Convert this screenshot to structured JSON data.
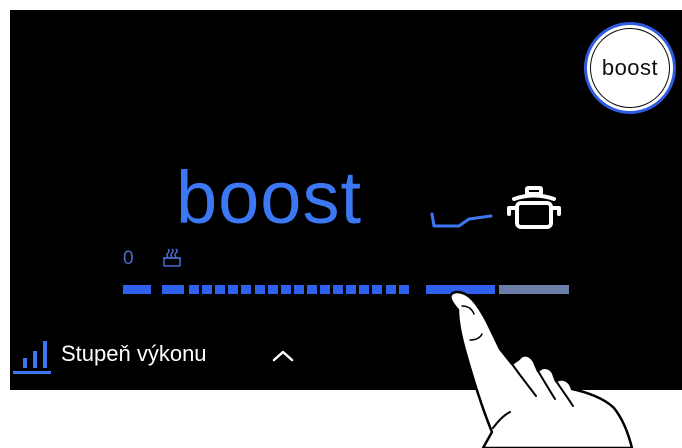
{
  "boost_button": {
    "label": "boost"
  },
  "display": {
    "mode_text": "boost"
  },
  "power_level": {
    "min_label": "0"
  },
  "footer": {
    "label": "Stupeň výkonu"
  },
  "colors": {
    "accent": "#3d78f4",
    "slider_active": "#2f61ee",
    "slider_inactive": "#6a7ea9",
    "background": "#000000"
  },
  "icons": [
    "pan-icon",
    "pot-icon",
    "steam-icon",
    "bar-chart-icon",
    "chevron-up-icon",
    "pointing-hand"
  ]
}
